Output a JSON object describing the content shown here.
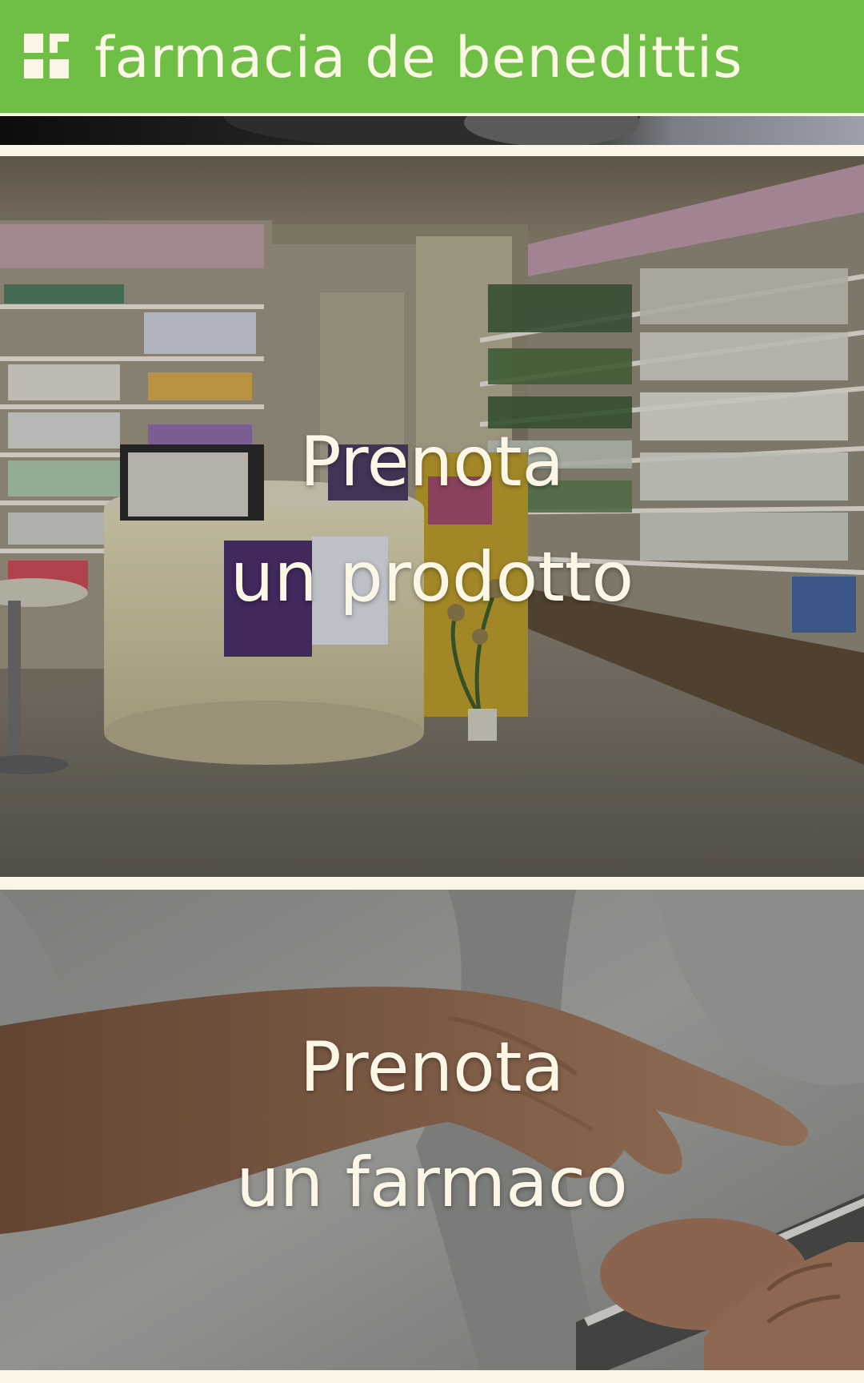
{
  "header": {
    "brand": "farmacia de benedittis",
    "logo_icon": "pharmacy-squares-logo",
    "brand_color": "#6fbe45"
  },
  "cards": [
    {
      "line1": "Prenota",
      "line2": "un prodotto",
      "image": "pharmacy-store-interior"
    },
    {
      "line1": "Prenota",
      "line2": "un farmaco",
      "image": "hand-using-tablet"
    }
  ]
}
